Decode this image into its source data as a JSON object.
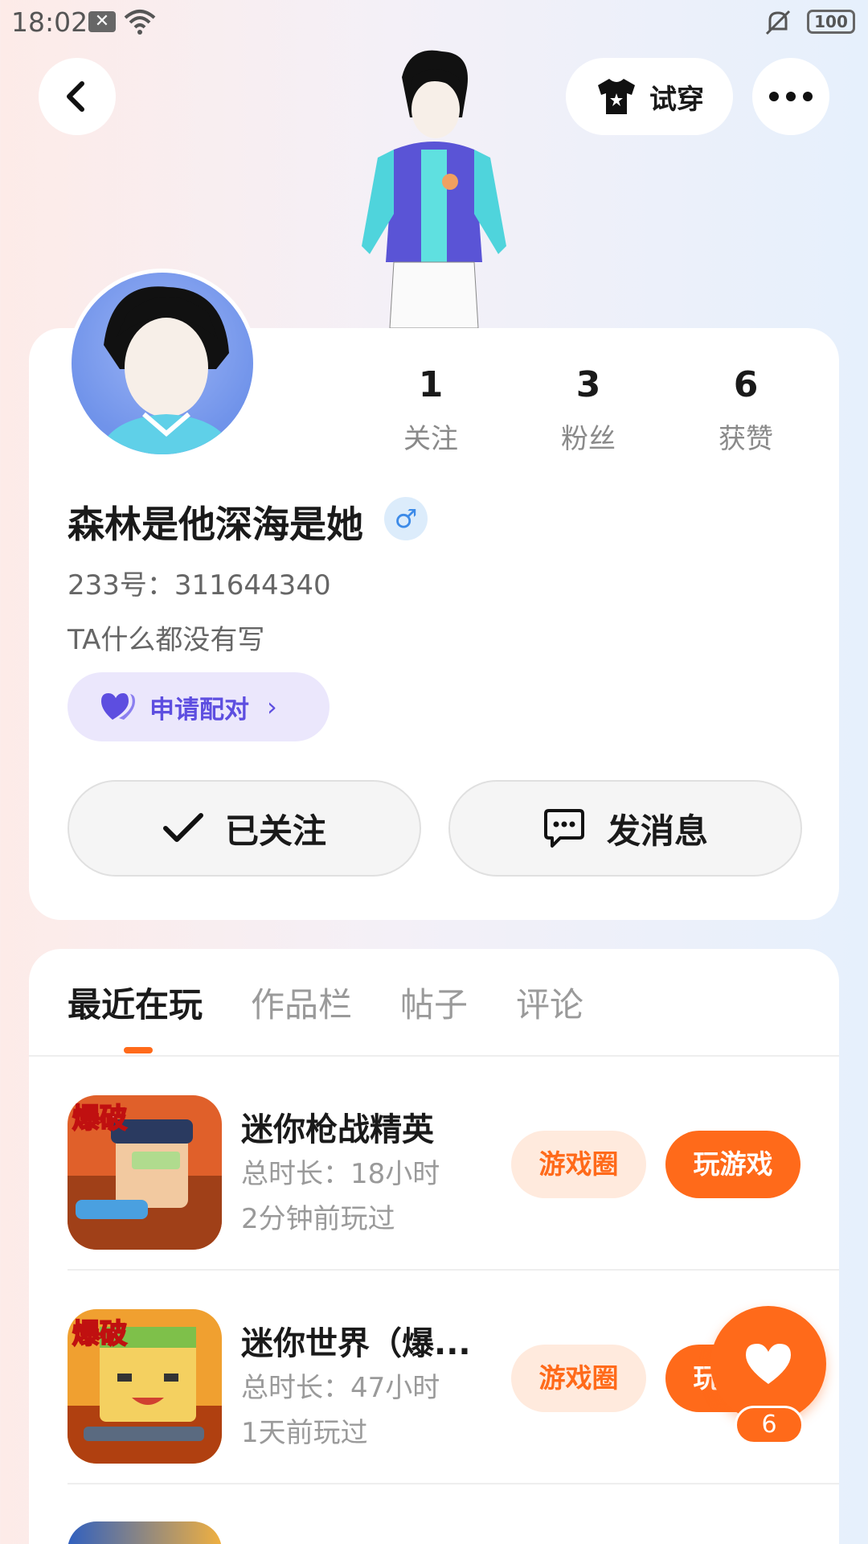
{
  "status_bar": {
    "time": "18:02",
    "battery": "100"
  },
  "header": {
    "try_on_label": "试穿"
  },
  "profile": {
    "stats": [
      {
        "num": "1",
        "label": "关注"
      },
      {
        "num": "3",
        "label": "粉丝"
      },
      {
        "num": "6",
        "label": "获赞"
      }
    ],
    "name": "森林是他深海是她",
    "gender_symbol": "♂",
    "uid": "233号：311644340",
    "bio": "TA什么都没有写",
    "pair_label": "申请配对",
    "follow_label": "已关注",
    "message_label": "发消息"
  },
  "tabs": [
    "最近在玩",
    "作品栏",
    "帖子",
    "评论"
  ],
  "games": [
    {
      "title": "迷你枪战精英",
      "duration": "总时长：18小时",
      "last_played": "2分钟前玩过",
      "circle_label": "游戏圈",
      "play_label": "玩游戏"
    },
    {
      "title": "迷你世界（爆...",
      "duration": "总时长：47小时",
      "last_played": "1天前玩过",
      "circle_label": "游戏圈",
      "play_label": "玩游戏"
    }
  ],
  "like": {
    "count": "6"
  },
  "colors": {
    "accent": "#ff6a1a",
    "pair": "#5d4ee0",
    "gender": "#3d8be8"
  }
}
